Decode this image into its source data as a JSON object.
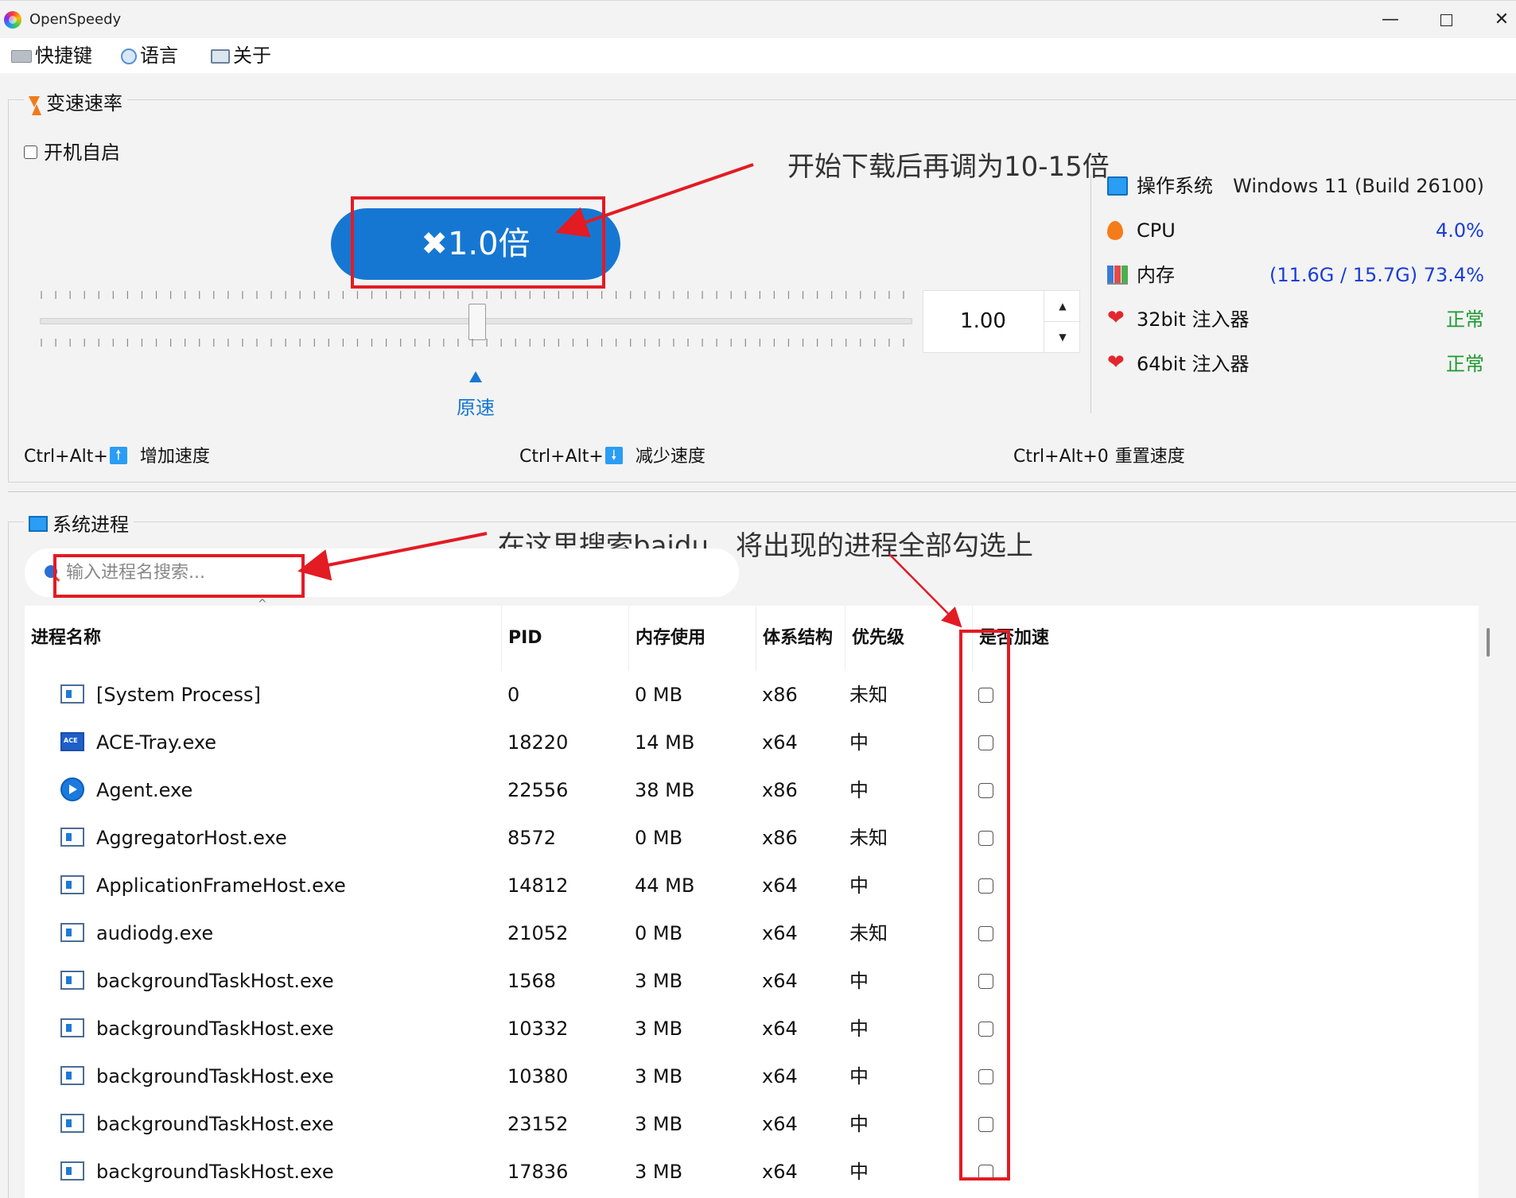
{
  "window": {
    "title": "OpenSpeedy",
    "min_glyph": "—",
    "close_glyph": "✕"
  },
  "menu": [
    {
      "label": "快捷键",
      "icon": "keyboard-icon"
    },
    {
      "label": "语言",
      "icon": "globe-icon"
    },
    {
      "label": "关于",
      "icon": "book-icon"
    }
  ],
  "speed": {
    "group_title": "变速速率",
    "autostart_label": "开机自启",
    "autostart_checked": false,
    "multiplier_label": "✖1.0倍",
    "slider_value": 1.0,
    "spin_value": "1.00",
    "spin_up": "▲",
    "spin_down": "▼",
    "original_speed_label": "原速",
    "hotkeys": [
      {
        "prefix": "Ctrl+Alt+",
        "key_icon": "up-arrow-icon",
        "key_glyph": "🠕",
        "text": "增加速度"
      },
      {
        "prefix": "Ctrl+Alt+",
        "key_icon": "down-arrow-icon",
        "key_glyph": "🠗",
        "text": "减少速度"
      },
      {
        "prefix": "Ctrl+Alt+0",
        "text": "重置速度"
      }
    ]
  },
  "system_info": [
    {
      "icon": "monitor-icon",
      "label": "操作系统",
      "value": "Windows 11 (Build 26100)"
    },
    {
      "icon": "flame-icon",
      "label": "CPU",
      "value": "4.0%"
    },
    {
      "icon": "chart-icon",
      "label": "内存",
      "value": "(11.6G / 15.7G) 73.4%"
    },
    {
      "icon": "heart-icon",
      "label": "32bit 注入器",
      "value": "正常"
    },
    {
      "icon": "heart-icon",
      "label": "64bit 注入器",
      "value": "正常"
    }
  ],
  "colors": {
    "accent_blue": "#1677d2",
    "annotation_red": "#e31b23",
    "status_ok": "#1e9b2f",
    "value_blue": "#1a3ed6"
  },
  "processes": {
    "group_title": "系统进程",
    "search_placeholder": "输入进程名搜索...",
    "sort_indicator": "^",
    "columns": [
      "进程名称",
      "PID",
      "内存使用",
      "体系结构",
      "优先级",
      "是否加速"
    ],
    "rows": [
      {
        "icon": "generic",
        "name": "[System Process]",
        "pid": "0",
        "mem": "0 MB",
        "arch": "x86",
        "priority": "未知"
      },
      {
        "icon": "ace",
        "name": "ACE-Tray.exe",
        "pid": "18220",
        "mem": "14 MB",
        "arch": "x64",
        "priority": "中"
      },
      {
        "icon": "agent",
        "name": "Agent.exe",
        "pid": "22556",
        "mem": "38 MB",
        "arch": "x86",
        "priority": "中"
      },
      {
        "icon": "generic",
        "name": "AggregatorHost.exe",
        "pid": "8572",
        "mem": "0 MB",
        "arch": "x86",
        "priority": "未知"
      },
      {
        "icon": "generic",
        "name": "ApplicationFrameHost.exe",
        "pid": "14812",
        "mem": "44 MB",
        "arch": "x64",
        "priority": "中"
      },
      {
        "icon": "generic",
        "name": "audiodg.exe",
        "pid": "21052",
        "mem": "0 MB",
        "arch": "x64",
        "priority": "未知"
      },
      {
        "icon": "generic",
        "name": "backgroundTaskHost.exe",
        "pid": "1568",
        "mem": "3 MB",
        "arch": "x64",
        "priority": "中"
      },
      {
        "icon": "generic",
        "name": "backgroundTaskHost.exe",
        "pid": "10332",
        "mem": "3 MB",
        "arch": "x64",
        "priority": "中"
      },
      {
        "icon": "generic",
        "name": "backgroundTaskHost.exe",
        "pid": "10380",
        "mem": "3 MB",
        "arch": "x64",
        "priority": "中"
      },
      {
        "icon": "generic",
        "name": "backgroundTaskHost.exe",
        "pid": "23152",
        "mem": "3 MB",
        "arch": "x64",
        "priority": "中"
      },
      {
        "icon": "generic",
        "name": "backgroundTaskHost.exe",
        "pid": "17836",
        "mem": "3 MB",
        "arch": "x64",
        "priority": "中"
      }
    ]
  },
  "annotations": {
    "speed_hint": "开始下载后再调为10-15倍",
    "search_hint": "在这里搜索baidu，将出现的进程全部勾选上"
  }
}
